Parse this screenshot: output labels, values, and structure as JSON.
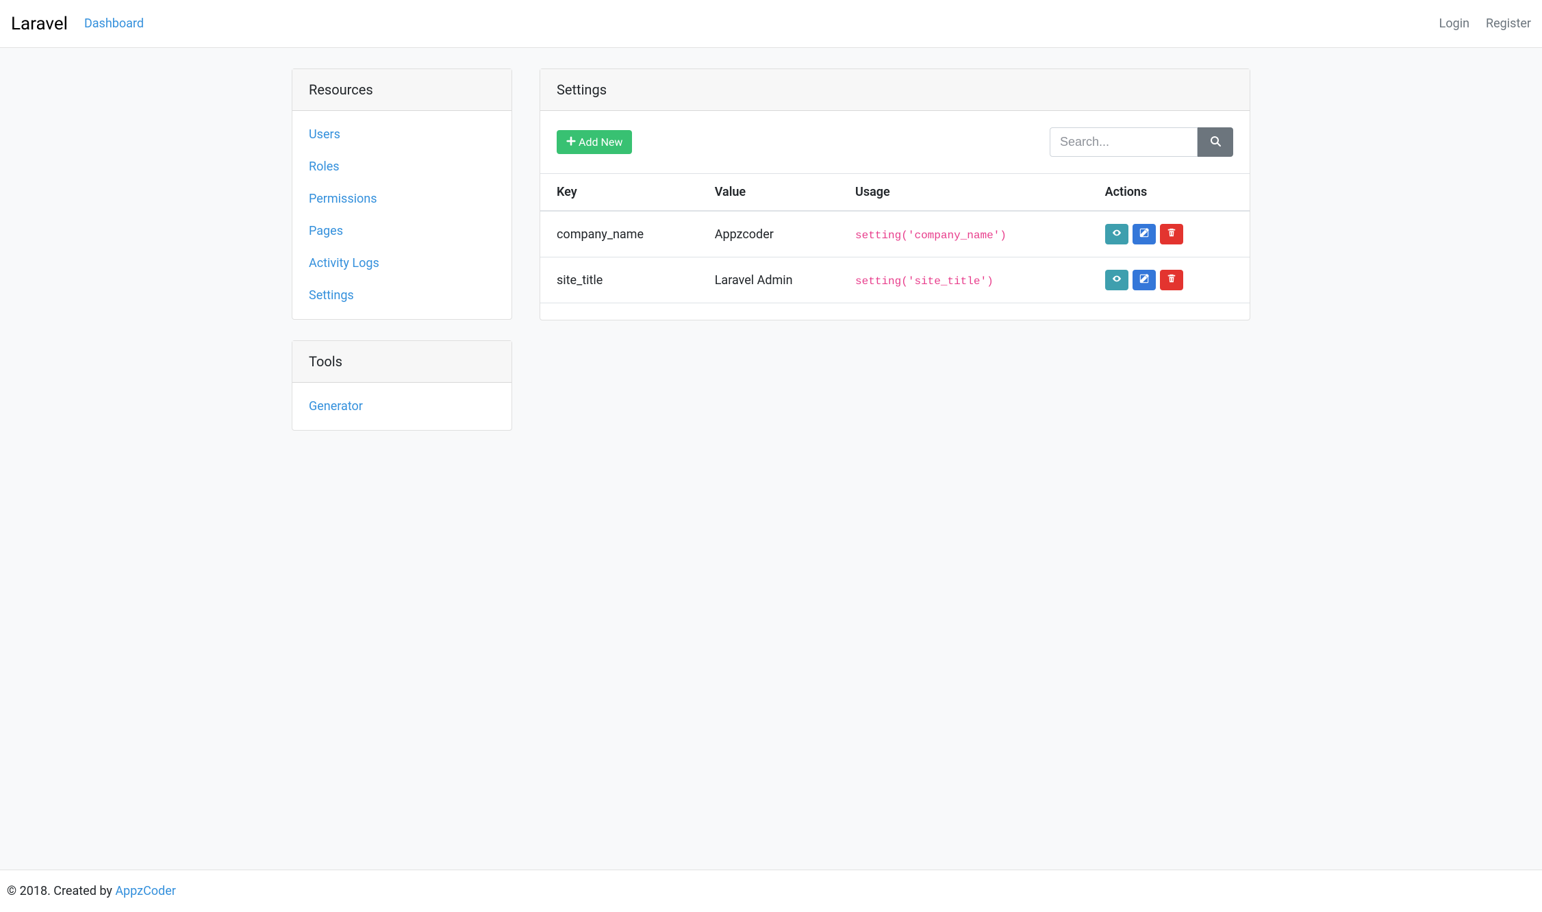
{
  "navbar": {
    "brand": "Laravel",
    "dashboard": "Dashboard",
    "login": "Login",
    "register": "Register"
  },
  "sidebar": {
    "resources": {
      "title": "Resources",
      "items": [
        "Users",
        "Roles",
        "Permissions",
        "Pages",
        "Activity Logs",
        "Settings"
      ]
    },
    "tools": {
      "title": "Tools",
      "items": [
        "Generator"
      ]
    }
  },
  "main": {
    "title": "Settings",
    "add_new": "Add New",
    "search_placeholder": "Search...",
    "columns": [
      "Key",
      "Value",
      "Usage",
      "Actions"
    ],
    "rows": [
      {
        "key": "company_name",
        "value": "Appzcoder",
        "usage": "setting('company_name')"
      },
      {
        "key": "site_title",
        "value": "Laravel Admin",
        "usage": "setting('site_title')"
      }
    ]
  },
  "footer": {
    "text": "© 2018. Created by ",
    "link": "AppzCoder"
  }
}
